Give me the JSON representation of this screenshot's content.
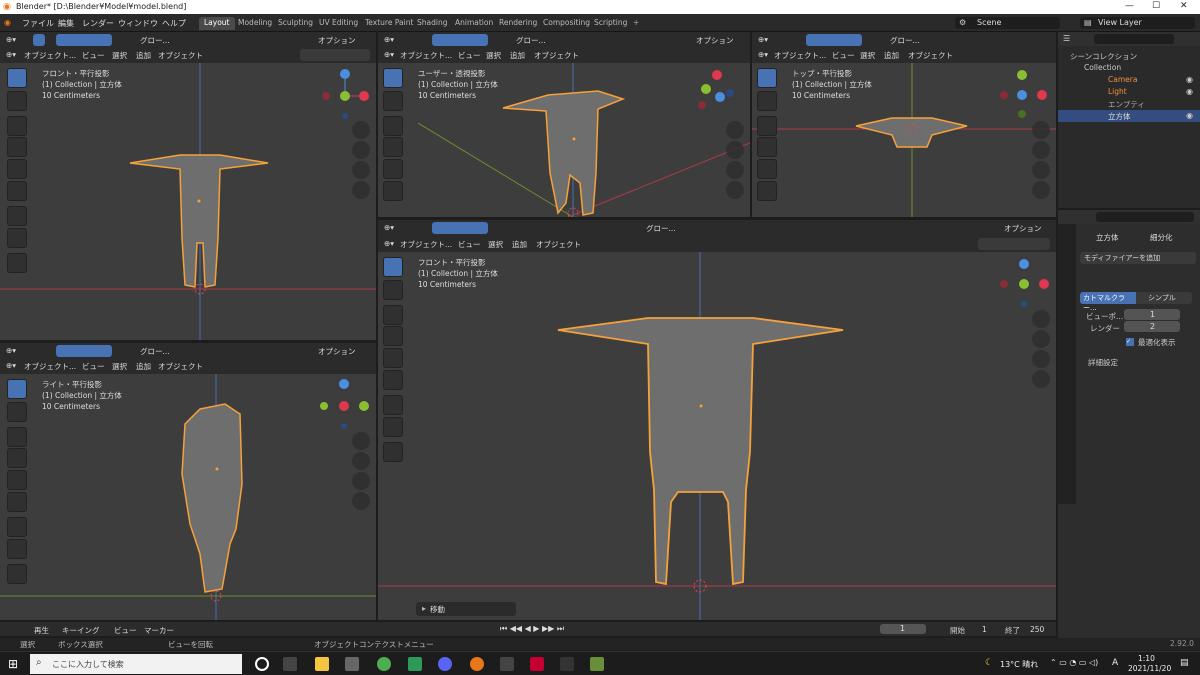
{
  "titlebar": {
    "title": "Blender* [D:\\Blender¥Model¥model.blend]"
  },
  "menu": [
    "ファイル",
    "編集",
    "レンダー",
    "ウィンドウ",
    "ヘルプ"
  ],
  "workspaces": [
    "Layout",
    "Modeling",
    "Sculpting",
    "UV Editing",
    "Texture Paint",
    "Shading",
    "Animation",
    "Rendering",
    "Compositing",
    "Scripting"
  ],
  "scene": "Scene",
  "view_layer": "View Layer",
  "viewport_header": {
    "mode": "オブジェクト...",
    "view": "ビュー",
    "select": "選択",
    "add": "追加",
    "object": "オブジェクト",
    "orientation": "グロー...",
    "options": "オプション"
  },
  "viewports": {
    "front_small": {
      "title": "フロント・平行投影",
      "collection": "(1) Collection | 立方体",
      "scale": "10 Centimeters"
    },
    "user": {
      "title": "ユーザー・透視投影",
      "collection": "(1) Collection | 立方体",
      "scale": "10 Centimeters"
    },
    "top": {
      "title": "トップ・平行投影",
      "collection": "(1) Collection | 立方体",
      "scale": "10 Centimeters"
    },
    "right": {
      "title": "ライト・平行投影",
      "collection": "(1) Collection | 立方体",
      "scale": "10 Centimeters"
    },
    "front_large": {
      "title": "フロント・平行投影",
      "collection": "(1) Collection | 立方体",
      "scale": "10 Centimeters"
    }
  },
  "last_op": "移動",
  "outliner": {
    "scene_collection": "シーンコレクション",
    "items": [
      "Collection",
      "Camera",
      "Light",
      "エンプティ",
      "立方体"
    ]
  },
  "properties": {
    "object": "立方体",
    "sub_label": "細分化",
    "add_modifier": "モディファイアーを追加",
    "tabs": [
      "カトマルクラー...",
      "シンプル"
    ],
    "viewport_label": "ビューポ...",
    "viewport_value": "1",
    "render_label": "レンダー",
    "render_value": "2",
    "optimal": "最適化表示",
    "advanced": "詳細設定"
  },
  "timeline": {
    "playback": "再生",
    "keying": "キーイング",
    "view": "ビュー",
    "marker": "マーカー",
    "current": "1",
    "start_label": "開始",
    "start": "1",
    "end_label": "終了",
    "end": "250"
  },
  "status": {
    "select": "選択",
    "box": "ボックス選択",
    "rotate": "ビューを回転",
    "context": "オブジェクトコンテクストメニュー",
    "version": "2.92.0"
  },
  "taskbar": {
    "search": "ここに入力して検索",
    "temp": "13°C 晴れ",
    "ime": "A",
    "time": "1:10",
    "date": "2021/11/20"
  },
  "colors": {
    "accent": "#4772b3",
    "selection": "#f5a23a",
    "x_axis": "#e0384f",
    "y_axis": "#8bbf32",
    "z_axis": "#4a8fe0"
  }
}
